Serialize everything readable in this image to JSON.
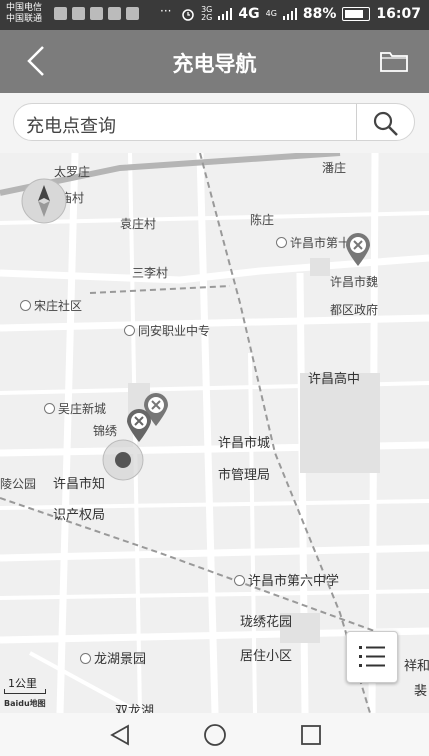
{
  "status": {
    "carrier1": "中国电信",
    "carrier2": "中国联通",
    "dots": "···",
    "net_small_1": "3G",
    "net_small_2": "2G",
    "net_4g": "4G",
    "net_small_3": "4G",
    "battery_pct": "88%",
    "time": "16:07"
  },
  "header": {
    "title": "充电导航"
  },
  "search": {
    "placeholder": "充电点查询"
  },
  "map": {
    "labels": [
      "太罗庄",
      "潘庄",
      "小庙村",
      "袁庄村",
      "陈庄",
      "许昌市第十",
      "许昌市魏",
      "都区政府",
      "三李村",
      "宋庄社区",
      "同安职业中专",
      "许昌高中",
      "吴庄新城",
      "锦绣",
      "许昌市城",
      "市管理局",
      "陵公园",
      "许昌市知",
      "识产权局",
      "许昌市第六中学",
      "珑绣花园",
      "居住小区",
      "龙湖景园",
      "祥和",
      "裴",
      "双龙湖"
    ],
    "scale_label": "1公里",
    "logo": "Baidu地图"
  },
  "colors": {
    "header_bg": "#7c7c7c",
    "status_bg": "#3a3a3a",
    "map_bg": "#f0f0f0"
  }
}
